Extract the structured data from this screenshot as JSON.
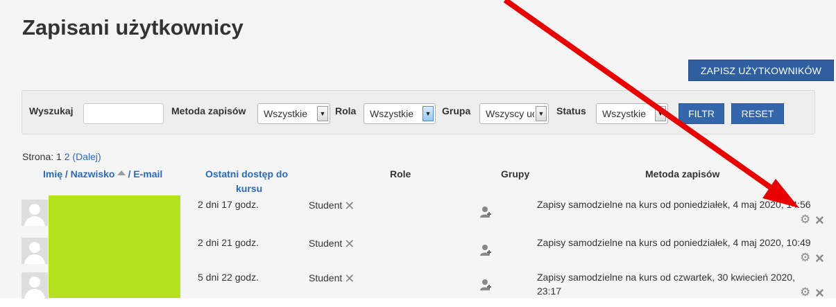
{
  "page": {
    "title": "Zapisani użytkownicy"
  },
  "toolbar": {
    "enrol_label": "ZAPISZ UŻYTKOWNIKÓW"
  },
  "filters": {
    "search_label": "Wyszukaj",
    "search_value": "",
    "method_label": "Metoda zapisów",
    "method_value": "Wszystkie",
    "role_label": "Rola",
    "role_value": "Wszystkie",
    "group_label": "Grupa",
    "group_value": "Wszyscy uc",
    "status_label": "Status",
    "status_value": "Wszystkie",
    "filter_button": "FILTR",
    "reset_button": "RESET"
  },
  "paging": {
    "label": "Strona:",
    "page1": "1",
    "page2": "2",
    "next": "(Dalej)"
  },
  "table": {
    "headers": {
      "name": "Imię / Nazwisko",
      "email": "/ E-mail",
      "last_access_1": "Ostatni dostęp do",
      "last_access_2": "kursu",
      "roles": "Role",
      "groups": "Grupy",
      "method": "Metoda zapisów"
    },
    "rows": [
      {
        "last_access": "2 dni 17 godz.",
        "role": "Student",
        "method_1": "Zapisy samodzielne na kurs od poniedziałek, 4 maj 2020, 14:56",
        "method_2": ""
      },
      {
        "last_access": "2 dni 21 godz.",
        "role": "Student",
        "method_1": "Zapisy samodzielne na kurs od poniedziałek, 4 maj 2020, 10:49",
        "method_2": ""
      },
      {
        "last_access": "5 dni 22 godz.",
        "role": "Student",
        "method_1": "Zapisy samodzielne na kurs od czwartek, 30 kwiecień 2020,",
        "method_2": "23:17"
      }
    ]
  },
  "colors": {
    "primary_button": "#3366aa",
    "link": "#2a6ab5",
    "redaction": "#b3e11e",
    "annotation_arrow": "#e60000"
  },
  "icons": {
    "sort": "sort-asc-icon",
    "role_remove": "close-icon",
    "group_add": "add-user-icon",
    "settings": "gear-icon",
    "unenrol": "close-icon"
  }
}
